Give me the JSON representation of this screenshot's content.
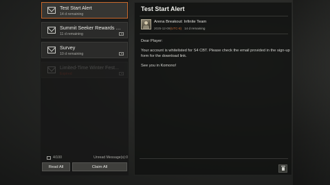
{
  "mail_list": [
    {
      "title": "Test Start Alert",
      "remaining": "14 d remaining",
      "selected": true,
      "attachment": false
    },
    {
      "title": "Summit Seeker Rewards Di...",
      "remaining": "11 d remaining",
      "selected": false,
      "attachment": true
    },
    {
      "title": "Survey",
      "remaining": "10 d remaining",
      "selected": false,
      "attachment": true
    },
    {
      "title": "Limited-Time Winter Fest...",
      "remaining": "Expired",
      "selected": false,
      "attachment": true
    }
  ],
  "footer": {
    "capacity": "4/100",
    "unread": "Unread Message(s):0",
    "read_all": "Read All",
    "claim_all": "Claim All"
  },
  "detail": {
    "title": "Test Start Alert",
    "sender": "Arena Breakout: Infinite Team",
    "date": "2025-12-09",
    "timezone": "(UTC-8)",
    "remaining": "14 d remaining",
    "body": [
      "Dear Player:",
      "Your account is whitelisted for S4 CBT. Please check the email provided in the sign-up",
      "form for the download link.",
      "See you in Komono!"
    ]
  },
  "icons": {
    "mail": "mail-icon",
    "attachment": "attachment-icon",
    "trash": "trash-icon"
  },
  "colors": {
    "accent": "#c8692c",
    "expired": "#c0452f"
  }
}
